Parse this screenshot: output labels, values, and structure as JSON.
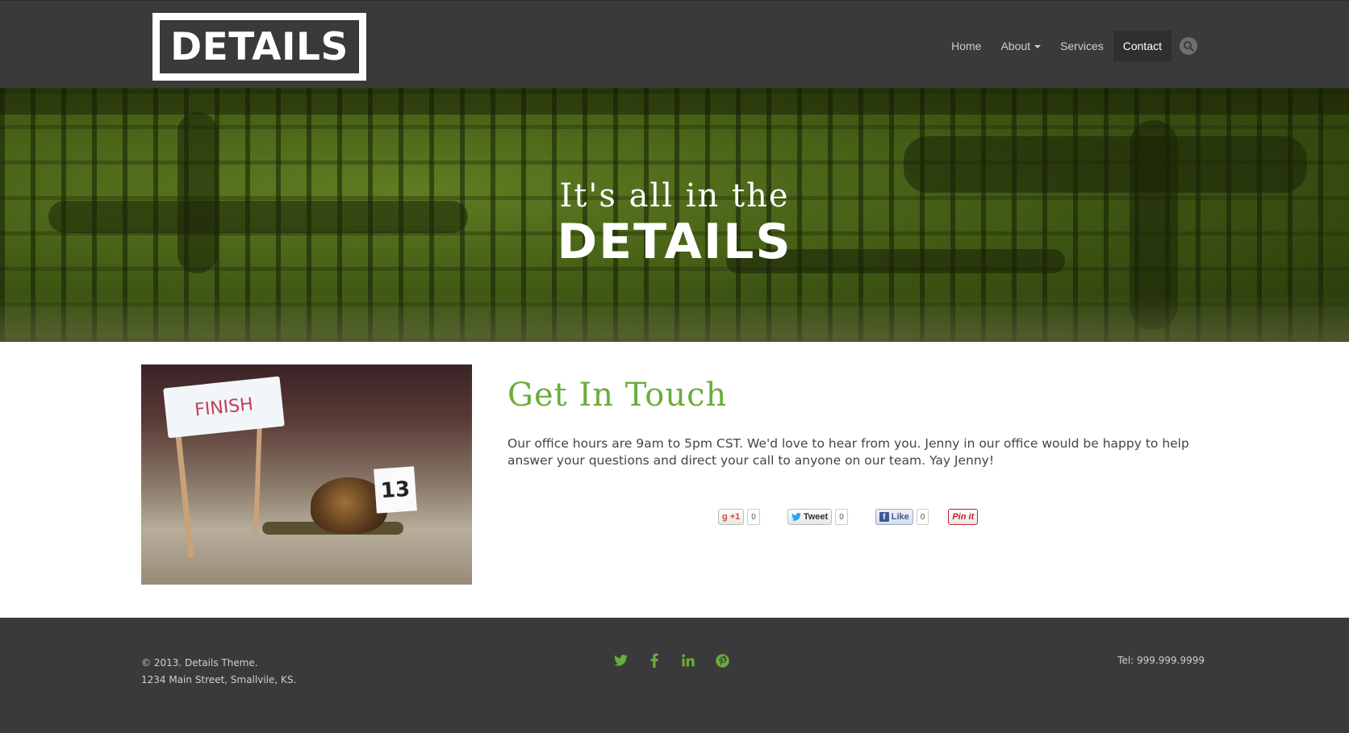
{
  "header": {
    "logo_text": "DETAILS",
    "nav": [
      {
        "label": "Home"
      },
      {
        "label": "About"
      },
      {
        "label": "Services"
      },
      {
        "label": "Contact"
      }
    ]
  },
  "hero": {
    "line1": "It's all in the",
    "line2": "DETAILS"
  },
  "photo": {
    "flag_text": "FINISH",
    "tag_text": "13"
  },
  "contact": {
    "title": "Get In Touch",
    "body": "Our office hours are 9am to 5pm CST. We'd love to hear from you. Jenny in our office would be happy to help answer your questions and direct your call to anyone on our team. Yay Jenny!"
  },
  "social": {
    "gplus_label": "+1",
    "gplus_count": "0",
    "tweet_label": "Tweet",
    "tweet_count": "0",
    "like_label": "Like",
    "like_count": "0",
    "pin_label": "Pin it"
  },
  "footer": {
    "copyright": "© 2013. Details Theme.",
    "address": "1234 Main Street, Smallvile, KS.",
    "phone": "Tel: 999.999.9999",
    "icons": [
      "twitter-icon",
      "facebook-icon",
      "linkedin-icon",
      "pinterest-icon"
    ],
    "icon_color": "#6aad3d"
  },
  "colors": {
    "accent": "#6aad3d",
    "header_bg": "#3a3a3a"
  }
}
